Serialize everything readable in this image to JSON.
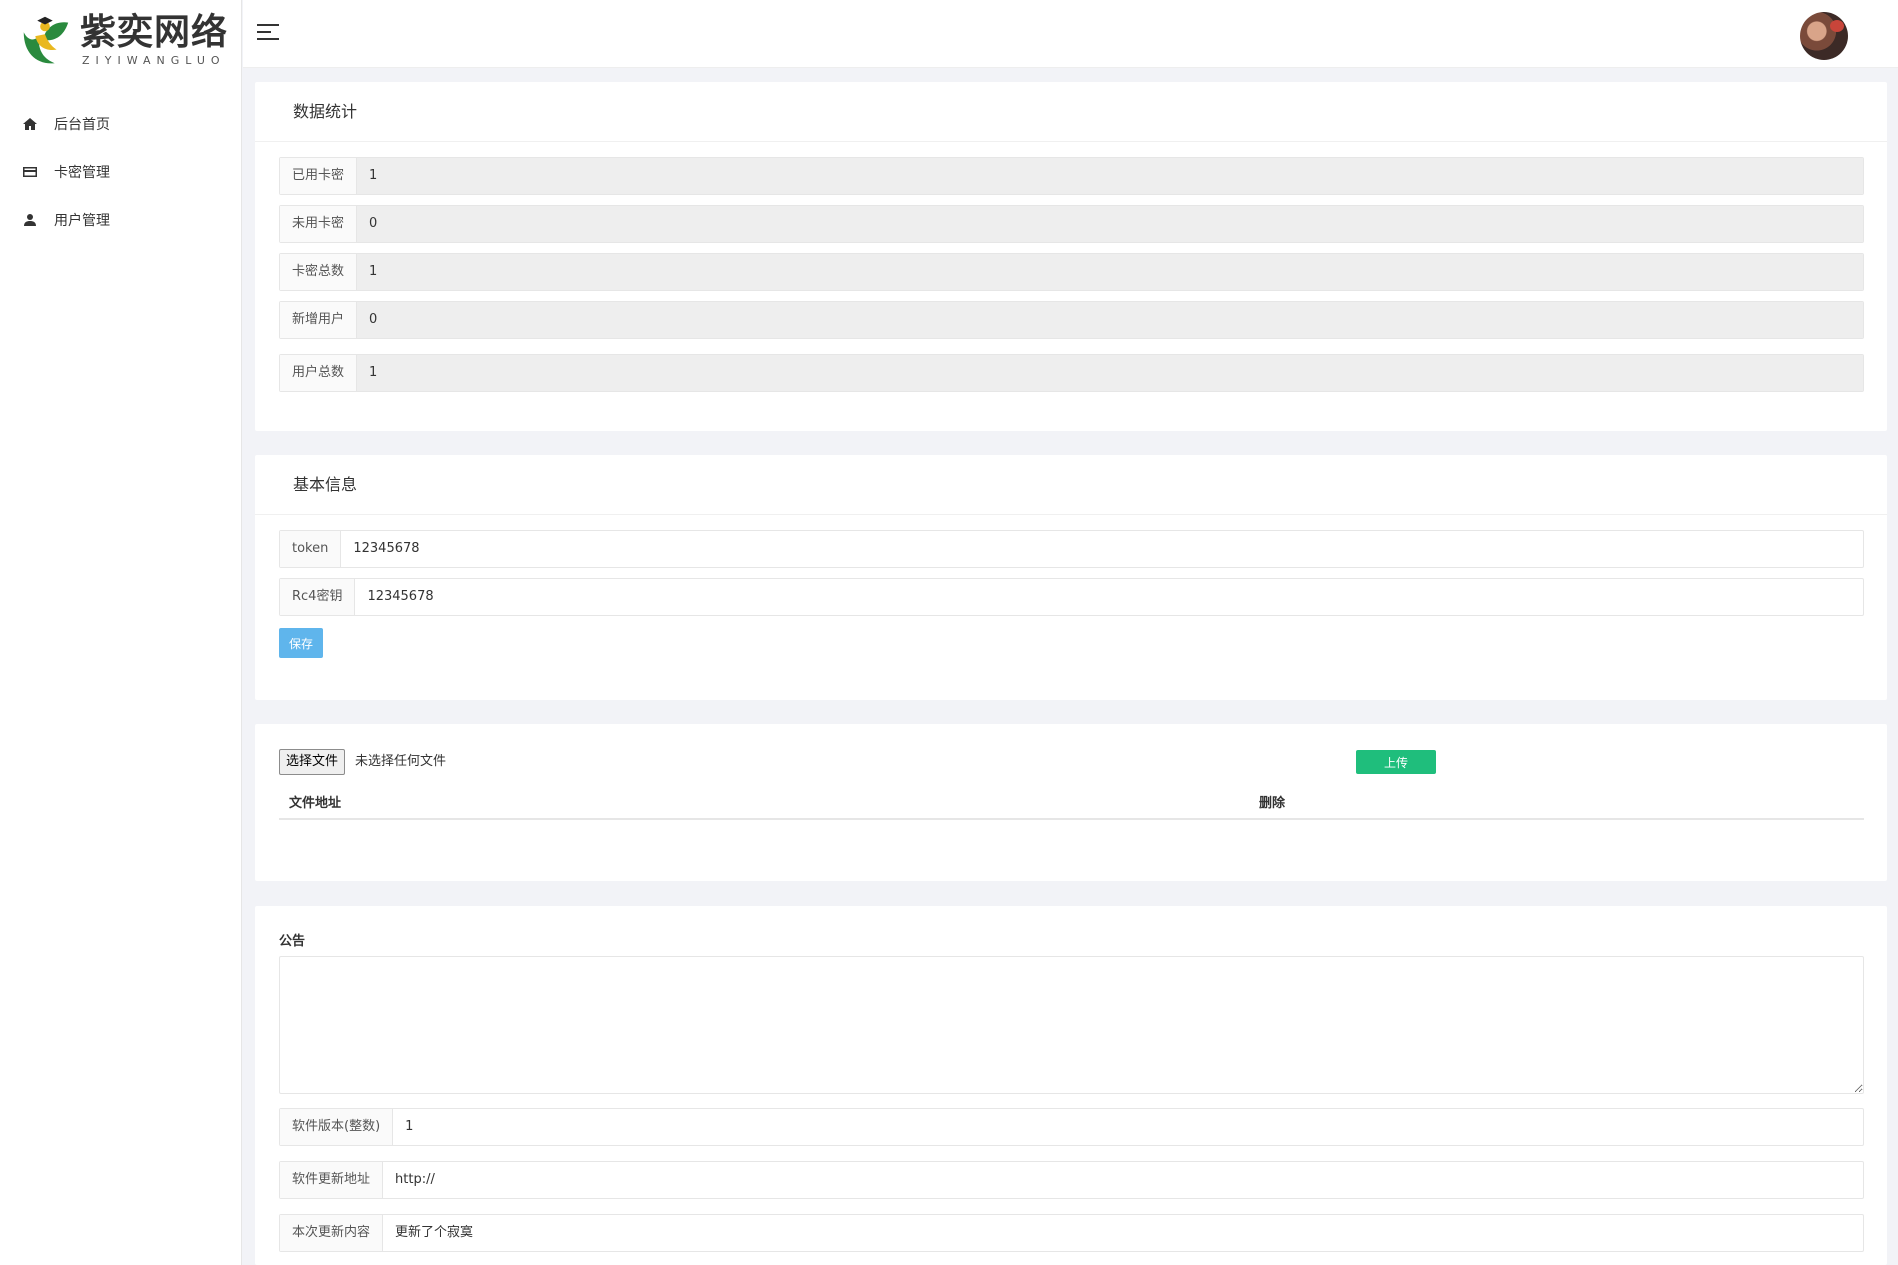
{
  "brand": {
    "title": "紫奕网络",
    "subtitle": "ZIYIWANGLUO",
    "accent": "#2a8a3e"
  },
  "sidebar": {
    "items": [
      {
        "label": "后台首页",
        "icon": "home-icon"
      },
      {
        "label": "卡密管理",
        "icon": "card-icon"
      },
      {
        "label": "用户管理",
        "icon": "user-icon"
      }
    ]
  },
  "stats": {
    "title": "数据统计",
    "rows": [
      {
        "label": "已用卡密",
        "value": "1"
      },
      {
        "label": "未用卡密",
        "value": "0"
      },
      {
        "label": "卡密总数",
        "value": "1"
      },
      {
        "label": "新增用户",
        "value": "0"
      },
      {
        "label": "用户总数",
        "value": "1"
      }
    ]
  },
  "basic": {
    "title": "基本信息",
    "token_label": "token",
    "token_value": "12345678",
    "rc4_label": "Rc4密钥",
    "rc4_value": "12345678",
    "save_label": "保存",
    "save_color": "#5fb5ec"
  },
  "upload": {
    "choose_label": "选择文件",
    "status": "未选择任何文件",
    "upload_label": "上传",
    "upload_color": "#1fbe7c",
    "columns": [
      "文件地址",
      "删除"
    ]
  },
  "notice": {
    "label": "公告",
    "text": "",
    "fields": [
      {
        "label": "软件版本(整数)",
        "value": "1"
      },
      {
        "label": "软件更新地址",
        "value": "http://"
      },
      {
        "label": "本次更新内容",
        "value": "更新了个寂寞"
      }
    ]
  }
}
